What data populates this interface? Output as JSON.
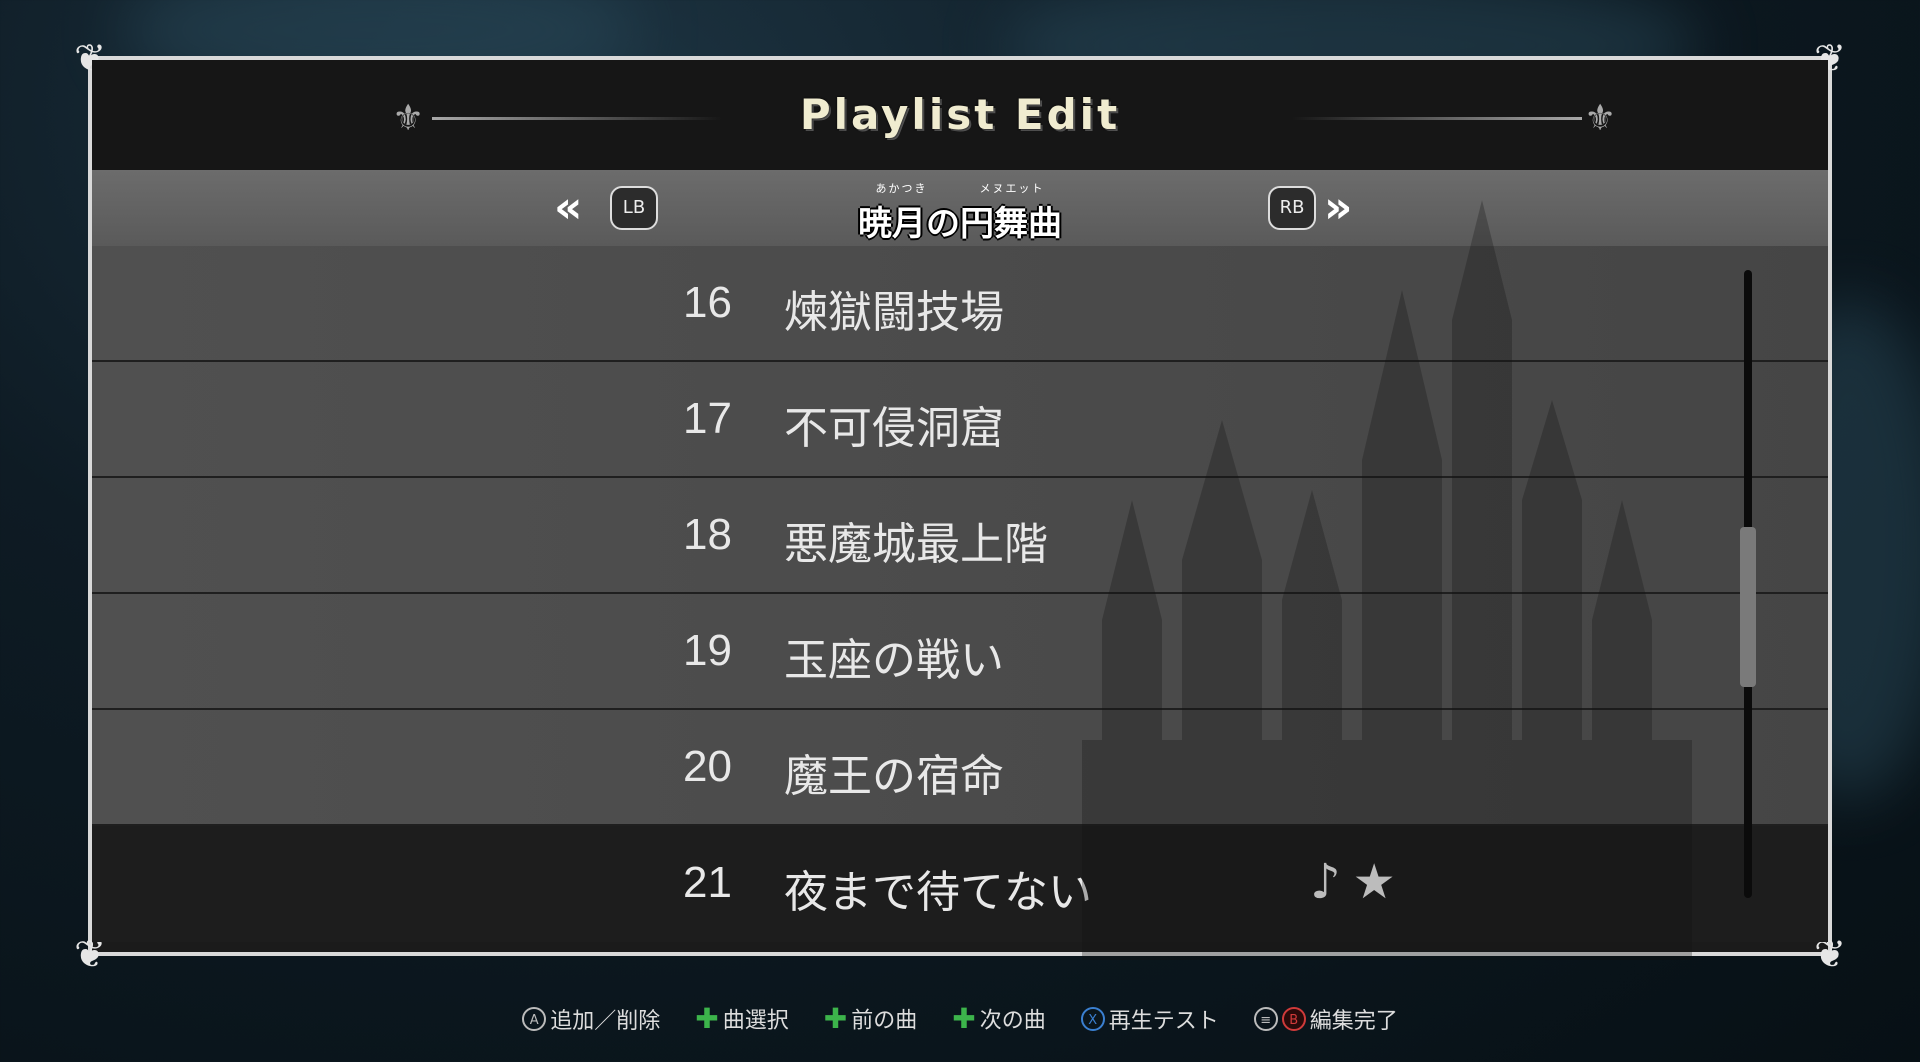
{
  "header": {
    "title": "Playlist Edit"
  },
  "tabbar": {
    "prev_button": "LB",
    "next_button": "RB",
    "ruby": "あかつき　　　　メヌエット",
    "label": "暁月の円舞曲"
  },
  "playlist": {
    "rows": [
      {
        "num": "16",
        "name": "煉獄闘技場",
        "icons": ""
      },
      {
        "num": "17",
        "name": "不可侵洞窟",
        "icons": ""
      },
      {
        "num": "18",
        "name": "悪魔城最上階",
        "icons": ""
      },
      {
        "num": "19",
        "name": "玉座の戦い",
        "icons": ""
      },
      {
        "num": "20",
        "name": "魔王の宿命",
        "icons": ""
      },
      {
        "num": "21",
        "name": "夜まで待てない",
        "icons": "♪★"
      }
    ],
    "selected_index": 5,
    "scroll_position": 0.55
  },
  "footer": {
    "hints": [
      {
        "icon": "A",
        "label": "追加／削除"
      },
      {
        "icon": "dpad",
        "label": "曲選択"
      },
      {
        "icon": "dpad",
        "label": "前の曲"
      },
      {
        "icon": "dpad",
        "label": "次の曲"
      },
      {
        "icon": "X",
        "label": "再生テスト"
      },
      {
        "icon": "B",
        "label": "編集完了"
      }
    ]
  },
  "icons": {
    "prev": "double-chevron-left-icon",
    "next": "double-chevron-right-icon",
    "note": "music-note-icon",
    "star": "star-icon"
  }
}
